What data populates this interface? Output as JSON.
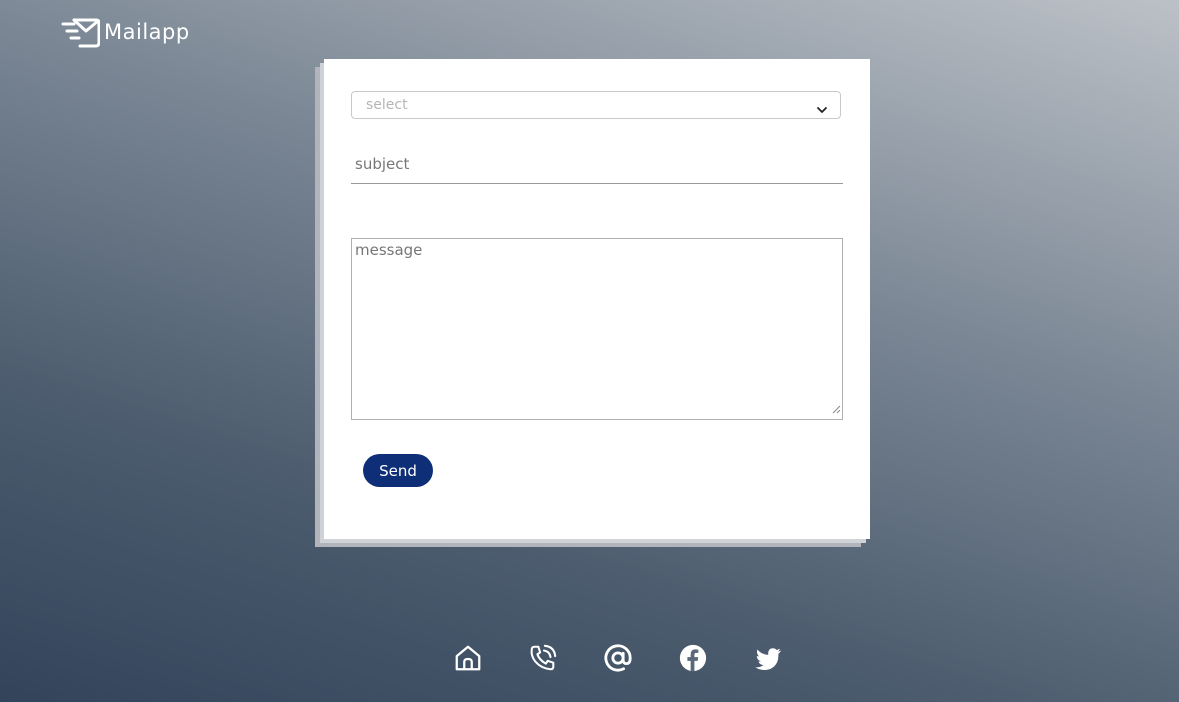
{
  "header": {
    "logo_text": "Mailapp",
    "logo_icon": "mail-icon"
  },
  "form": {
    "select": {
      "value": "select",
      "icon": "chevron-down-icon"
    },
    "subject": {
      "placeholder": "subject"
    },
    "message": {
      "placeholder": "message"
    },
    "send_label": "Send"
  },
  "footer": {
    "icons": [
      "home-icon",
      "phone-icon",
      "at-icon",
      "facebook-icon",
      "twitter-icon"
    ]
  },
  "colors": {
    "accent": "#0e2f78",
    "card": "#ffffff"
  }
}
